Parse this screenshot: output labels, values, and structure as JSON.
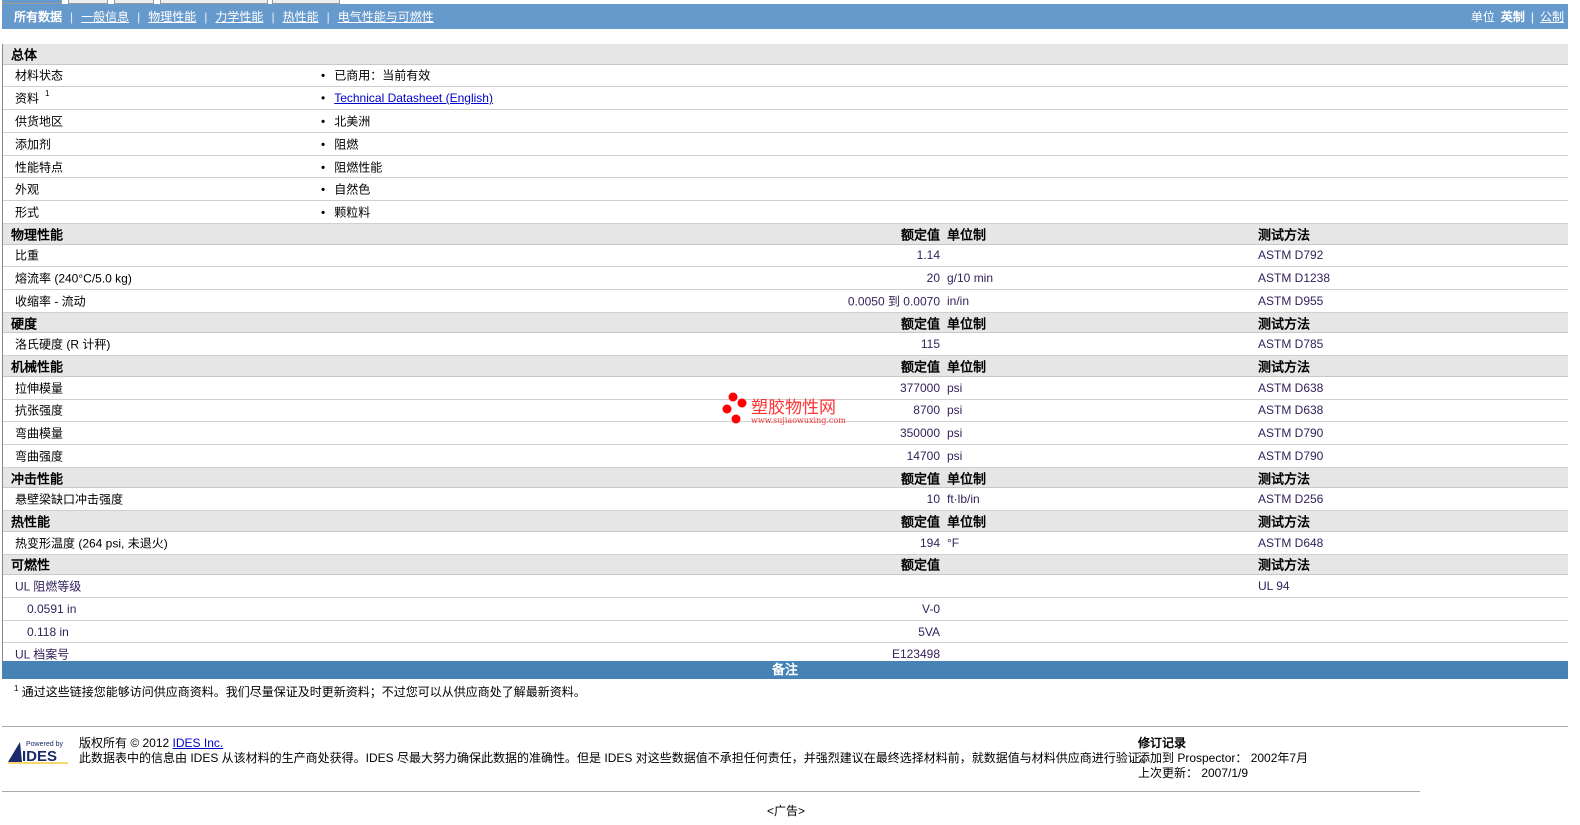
{
  "nav": {
    "items": [
      "所有数据",
      "一般信息",
      "物理性能",
      "力学性能",
      "热性能",
      "电气性能与可燃性"
    ],
    "units_label": "单位",
    "unit_imperial": "英制",
    "unit_metric": "公制"
  },
  "general": {
    "title": "总体",
    "rows": [
      {
        "label": "材料状态",
        "value": "已商用：当前有效"
      },
      {
        "label": "资料",
        "sup": "1",
        "value": "Technical Datasheet (English)",
        "link": true
      },
      {
        "label": "供货地区",
        "value": "北美洲"
      },
      {
        "label": "添加剂",
        "value": "阻燃"
      },
      {
        "label": "性能特点",
        "value": "阻燃性能"
      },
      {
        "label": "外观",
        "value": "自然色"
      },
      {
        "label": "形式",
        "value": "颗粒料"
      }
    ]
  },
  "col": {
    "nominal": "额定值",
    "unit": "单位制",
    "method": "测试方法"
  },
  "sections": [
    {
      "title": "物理性能",
      "rows": [
        {
          "label": "比重",
          "value": "1.14",
          "unit": "",
          "method": "ASTM D792"
        },
        {
          "label": "熔流率 (240°C/5.0 kg)",
          "value": "20",
          "unit": "g/10 min",
          "method": "ASTM D1238"
        },
        {
          "label": "收缩率 - 流动",
          "value": "0.0050 到  0.0070",
          "unit": "in/in",
          "method": "ASTM D955"
        }
      ]
    },
    {
      "title": "硬度",
      "rows": [
        {
          "label": "洛氏硬度 (R 计秤)",
          "value": "115",
          "unit": "",
          "method": "ASTM D785"
        }
      ]
    },
    {
      "title": "机械性能",
      "rows": [
        {
          "label": "拉伸模量",
          "value": "377000",
          "unit": "psi",
          "method": "ASTM D638"
        },
        {
          "label": "抗张强度",
          "value": "8700",
          "unit": "psi",
          "method": "ASTM D638"
        },
        {
          "label": "弯曲模量",
          "value": "350000",
          "unit": "psi",
          "method": "ASTM D790"
        },
        {
          "label": "弯曲强度",
          "value": "14700",
          "unit": "psi",
          "method": "ASTM D790"
        }
      ]
    },
    {
      "title": "冲击性能",
      "rows": [
        {
          "label": "悬壁梁缺口冲击强度",
          "value": "10",
          "unit": "ft·lb/in",
          "method": "ASTM D256"
        }
      ]
    },
    {
      "title": "热性能",
      "rows": [
        {
          "label": "热变形温度 (264 psi, 未退火)",
          "value": "194",
          "unit": "°F",
          "method": "ASTM D648"
        }
      ]
    }
  ],
  "flammability": {
    "title": "可燃性",
    "rows": [
      {
        "label": "UL 阻燃等级",
        "value": "",
        "method": "UL 94"
      },
      {
        "label": "0.0591 in",
        "value": "V-0",
        "sub": true
      },
      {
        "label": "0.118 in",
        "value": "5VA",
        "sub": true
      },
      {
        "label": "UL 档案号",
        "value": "E123498"
      }
    ]
  },
  "notes": {
    "title": "备注",
    "footnote_mark": "1",
    "footnote": "通过这些链接您能够访问供应商资料。我们尽量保证及时更新资料；不过您可以从供应商处了解最新资料。"
  },
  "footer": {
    "logo": "Powered by IDES",
    "copyright": "版权所有 © 2012 ",
    "company": "IDES Inc.",
    "disclaimer": "此数据表中的信息由 IDES 从该材料的生产商处获得。IDES 尽最大努力确保此数据的准确性。但是 IDES 对这些数据值不承担任何责任，并强烈建议在最终选择材料前，就数据值与材料供应商进行验证。",
    "rev_title": "修订记录",
    "added": "添加到 Prospector： 2002年7月",
    "updated": "上次更新： 2007/1/9"
  },
  "watermark": {
    "text": "塑胶物性网",
    "url": "www.sujiaowuxing.com"
  },
  "ad": "<广告>"
}
